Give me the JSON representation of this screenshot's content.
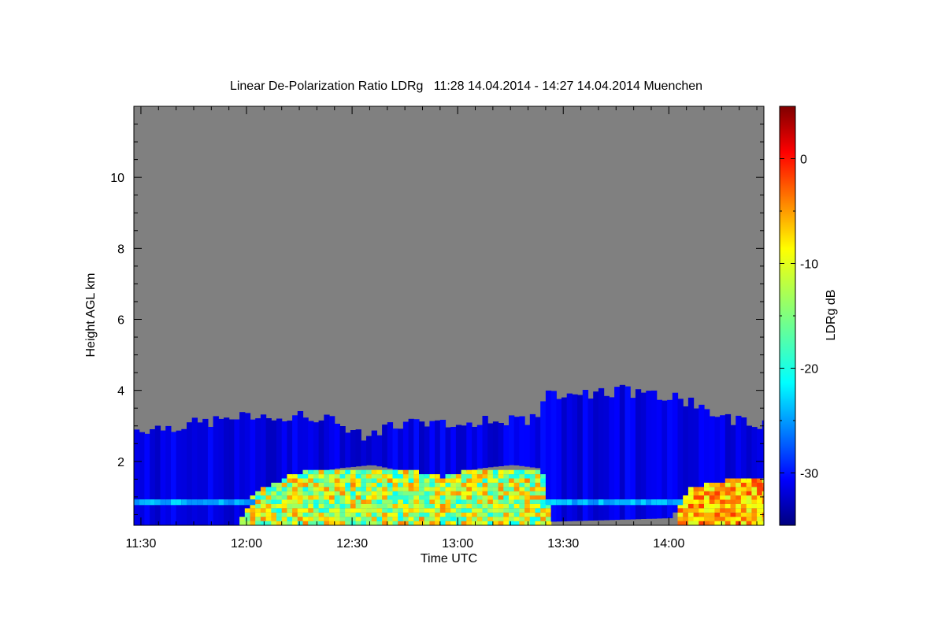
{
  "chart_data": {
    "type": "heatmap",
    "title": "Linear De-Polarization Ratio LDRg   11:28 14.04.2014 - 14:27 14.04.2014 Muenchen",
    "xlabel": "Time UTC",
    "ylabel": "Height AGL km",
    "colorbar_label": "LDRg dB",
    "x_range_minutes_utc": [
      688,
      867
    ],
    "x_ticks": [
      {
        "value": 690,
        "label": "11:30"
      },
      {
        "value": 720,
        "label": "12:00"
      },
      {
        "value": 750,
        "label": "12:30"
      },
      {
        "value": 780,
        "label": "13:00"
      },
      {
        "value": 810,
        "label": "13:30"
      },
      {
        "value": 840,
        "label": "14:00"
      }
    ],
    "y_range_km": [
      0.2,
      12.0
    ],
    "y_ticks": [
      {
        "value": 2,
        "label": "2"
      },
      {
        "value": 4,
        "label": "4"
      },
      {
        "value": 6,
        "label": "6"
      },
      {
        "value": 8,
        "label": "8"
      },
      {
        "value": 10,
        "label": "10"
      }
    ],
    "colorbar_range_db": [
      -35,
      5
    ],
    "colorbar_ticks": [
      {
        "value": 0,
        "label": "0"
      },
      {
        "value": -10,
        "label": "-10"
      },
      {
        "value": -20,
        "label": "-20"
      },
      {
        "value": -30,
        "label": "-30"
      }
    ],
    "colormap": "jet",
    "background_color": "#808080",
    "cloud_top_km": [
      {
        "time": 688,
        "top": 2.9
      },
      {
        "time": 700,
        "top": 3.0
      },
      {
        "time": 715,
        "top": 3.2
      },
      {
        "time": 725,
        "top": 3.3
      },
      {
        "time": 735,
        "top": 3.3
      },
      {
        "time": 745,
        "top": 3.1
      },
      {
        "time": 752,
        "top": 2.7
      },
      {
        "time": 760,
        "top": 3.0
      },
      {
        "time": 770,
        "top": 3.1
      },
      {
        "time": 780,
        "top": 3.1
      },
      {
        "time": 790,
        "top": 3.2
      },
      {
        "time": 800,
        "top": 3.1
      },
      {
        "time": 805,
        "top": 3.9
      },
      {
        "time": 815,
        "top": 3.9
      },
      {
        "time": 825,
        "top": 4.0
      },
      {
        "time": 835,
        "top": 3.9
      },
      {
        "time": 845,
        "top": 3.7
      },
      {
        "time": 855,
        "top": 3.2
      },
      {
        "time": 867,
        "top": 3.0
      }
    ],
    "cloud_bottom_km": [
      {
        "time": 688,
        "top": 0.2
      },
      {
        "time": 717,
        "top": 0.2
      },
      {
        "time": 722,
        "top": 1.1
      },
      {
        "time": 733,
        "top": 1.6
      },
      {
        "time": 745,
        "top": 1.8
      },
      {
        "time": 755,
        "top": 1.9
      },
      {
        "time": 765,
        "top": 1.7
      },
      {
        "time": 775,
        "top": 1.5
      },
      {
        "time": 785,
        "top": 1.8
      },
      {
        "time": 795,
        "top": 1.9
      },
      {
        "time": 803,
        "top": 1.8
      },
      {
        "time": 806,
        "top": 0.3
      },
      {
        "time": 840,
        "top": 0.4
      },
      {
        "time": 845,
        "top": 1.2
      },
      {
        "time": 855,
        "top": 1.4
      },
      {
        "time": 867,
        "top": 1.5
      }
    ],
    "cloud_value_db": -31,
    "boundary_band": {
      "height_km": 0.85,
      "value_db": -23
    },
    "aerosol_layer": {
      "time_range": [
        715,
        806
      ],
      "height_km": [
        0.2,
        1.7
      ],
      "value_db_range": [
        -20,
        -5
      ]
    },
    "aerosol_layer_2": {
      "time_range": [
        842,
        867
      ],
      "height_km": [
        0.2,
        1.6
      ],
      "value_db_range": [
        -12,
        -2
      ]
    }
  }
}
